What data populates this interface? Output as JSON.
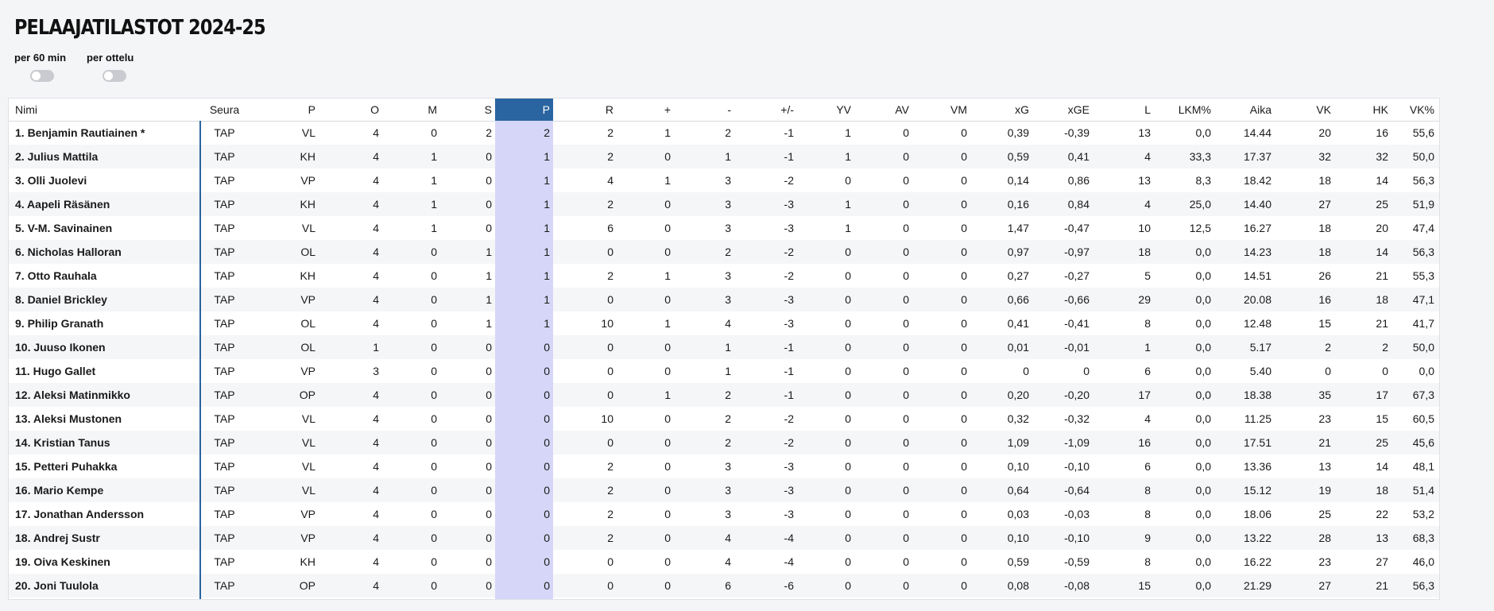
{
  "page": {
    "title": "PELAAJATILASTOT 2024-25",
    "toggles": [
      {
        "label": "per 60 min",
        "on": false
      },
      {
        "label": "per ottelu",
        "on": false
      }
    ]
  },
  "table": {
    "columns": [
      "Nimi",
      "Seura",
      "P",
      "O",
      "M",
      "S",
      "P",
      "R",
      "+",
      "-",
      "+/-",
      "YV",
      "AV",
      "VM",
      "xG",
      "xGE",
      "L",
      "LKM%",
      "Aika",
      "VK",
      "HK",
      "VK%"
    ],
    "sorted_column": 6,
    "accent_color": "#2a64a1",
    "highlight_color": "#d6d7f8",
    "rows": [
      [
        "1. Benjamin Rautiainen *",
        "TAP",
        "VL",
        "4",
        "0",
        "2",
        "2",
        "2",
        "1",
        "2",
        "-1",
        "1",
        "0",
        "0",
        "0,39",
        "-0,39",
        "13",
        "0,0",
        "14.44",
        "20",
        "16",
        "55,6"
      ],
      [
        "2. Julius Mattila",
        "TAP",
        "KH",
        "4",
        "1",
        "0",
        "1",
        "2",
        "0",
        "1",
        "-1",
        "1",
        "0",
        "0",
        "0,59",
        "0,41",
        "4",
        "33,3",
        "17.37",
        "32",
        "32",
        "50,0"
      ],
      [
        "3. Olli Juolevi",
        "TAP",
        "VP",
        "4",
        "1",
        "0",
        "1",
        "4",
        "1",
        "3",
        "-2",
        "0",
        "0",
        "0",
        "0,14",
        "0,86",
        "13",
        "8,3",
        "18.42",
        "18",
        "14",
        "56,3"
      ],
      [
        "4. Aapeli Räsänen",
        "TAP",
        "KH",
        "4",
        "1",
        "0",
        "1",
        "2",
        "0",
        "3",
        "-3",
        "1",
        "0",
        "0",
        "0,16",
        "0,84",
        "4",
        "25,0",
        "14.40",
        "27",
        "25",
        "51,9"
      ],
      [
        "5. V-M. Savinainen",
        "TAP",
        "VL",
        "4",
        "1",
        "0",
        "1",
        "6",
        "0",
        "3",
        "-3",
        "1",
        "0",
        "0",
        "1,47",
        "-0,47",
        "10",
        "12,5",
        "16.27",
        "18",
        "20",
        "47,4"
      ],
      [
        "6. Nicholas Halloran",
        "TAP",
        "OL",
        "4",
        "0",
        "1",
        "1",
        "0",
        "0",
        "2",
        "-2",
        "0",
        "0",
        "0",
        "0,97",
        "-0,97",
        "18",
        "0,0",
        "14.23",
        "18",
        "14",
        "56,3"
      ],
      [
        "7. Otto Rauhala",
        "TAP",
        "KH",
        "4",
        "0",
        "1",
        "1",
        "2",
        "1",
        "3",
        "-2",
        "0",
        "0",
        "0",
        "0,27",
        "-0,27",
        "5",
        "0,0",
        "14.51",
        "26",
        "21",
        "55,3"
      ],
      [
        "8. Daniel Brickley",
        "TAP",
        "VP",
        "4",
        "0",
        "1",
        "1",
        "0",
        "0",
        "3",
        "-3",
        "0",
        "0",
        "0",
        "0,66",
        "-0,66",
        "29",
        "0,0",
        "20.08",
        "16",
        "18",
        "47,1"
      ],
      [
        "9. Philip Granath",
        "TAP",
        "OL",
        "4",
        "0",
        "1",
        "1",
        "10",
        "1",
        "4",
        "-3",
        "0",
        "0",
        "0",
        "0,41",
        "-0,41",
        "8",
        "0,0",
        "12.48",
        "15",
        "21",
        "41,7"
      ],
      [
        "10. Juuso Ikonen",
        "TAP",
        "OL",
        "1",
        "0",
        "0",
        "0",
        "0",
        "0",
        "1",
        "-1",
        "0",
        "0",
        "0",
        "0,01",
        "-0,01",
        "1",
        "0,0",
        "5.17",
        "2",
        "2",
        "50,0"
      ],
      [
        "11. Hugo Gallet",
        "TAP",
        "VP",
        "3",
        "0",
        "0",
        "0",
        "0",
        "0",
        "1",
        "-1",
        "0",
        "0",
        "0",
        "0",
        "0",
        "6",
        "0,0",
        "5.40",
        "0",
        "0",
        "0,0"
      ],
      [
        "12. Aleksi Matinmikko",
        "TAP",
        "OP",
        "4",
        "0",
        "0",
        "0",
        "0",
        "1",
        "2",
        "-1",
        "0",
        "0",
        "0",
        "0,20",
        "-0,20",
        "17",
        "0,0",
        "18.38",
        "35",
        "17",
        "67,3"
      ],
      [
        "13. Aleksi Mustonen",
        "TAP",
        "VL",
        "4",
        "0",
        "0",
        "0",
        "10",
        "0",
        "2",
        "-2",
        "0",
        "0",
        "0",
        "0,32",
        "-0,32",
        "4",
        "0,0",
        "11.25",
        "23",
        "15",
        "60,5"
      ],
      [
        "14. Kristian Tanus",
        "TAP",
        "VL",
        "4",
        "0",
        "0",
        "0",
        "0",
        "0",
        "2",
        "-2",
        "0",
        "0",
        "0",
        "1,09",
        "-1,09",
        "16",
        "0,0",
        "17.51",
        "21",
        "25",
        "45,6"
      ],
      [
        "15. Petteri Puhakka",
        "TAP",
        "VL",
        "4",
        "0",
        "0",
        "0",
        "2",
        "0",
        "3",
        "-3",
        "0",
        "0",
        "0",
        "0,10",
        "-0,10",
        "6",
        "0,0",
        "13.36",
        "13",
        "14",
        "48,1"
      ],
      [
        "16. Mario Kempe",
        "TAP",
        "VL",
        "4",
        "0",
        "0",
        "0",
        "2",
        "0",
        "3",
        "-3",
        "0",
        "0",
        "0",
        "0,64",
        "-0,64",
        "8",
        "0,0",
        "15.12",
        "19",
        "18",
        "51,4"
      ],
      [
        "17. Jonathan Andersson",
        "TAP",
        "VP",
        "4",
        "0",
        "0",
        "0",
        "2",
        "0",
        "3",
        "-3",
        "0",
        "0",
        "0",
        "0,03",
        "-0,03",
        "8",
        "0,0",
        "18.06",
        "25",
        "22",
        "53,2"
      ],
      [
        "18. Andrej Sustr",
        "TAP",
        "VP",
        "4",
        "0",
        "0",
        "0",
        "2",
        "0",
        "4",
        "-4",
        "0",
        "0",
        "0",
        "0,10",
        "-0,10",
        "9",
        "0,0",
        "13.22",
        "28",
        "13",
        "68,3"
      ],
      [
        "19. Oiva Keskinen",
        "TAP",
        "KH",
        "4",
        "0",
        "0",
        "0",
        "0",
        "0",
        "4",
        "-4",
        "0",
        "0",
        "0",
        "0,59",
        "-0,59",
        "8",
        "0,0",
        "16.22",
        "23",
        "27",
        "46,0"
      ],
      [
        "20. Joni Tuulola",
        "TAP",
        "OP",
        "4",
        "0",
        "0",
        "0",
        "0",
        "0",
        "6",
        "-6",
        "0",
        "0",
        "0",
        "0,08",
        "-0,08",
        "15",
        "0,0",
        "21.29",
        "27",
        "21",
        "56,3"
      ]
    ]
  }
}
